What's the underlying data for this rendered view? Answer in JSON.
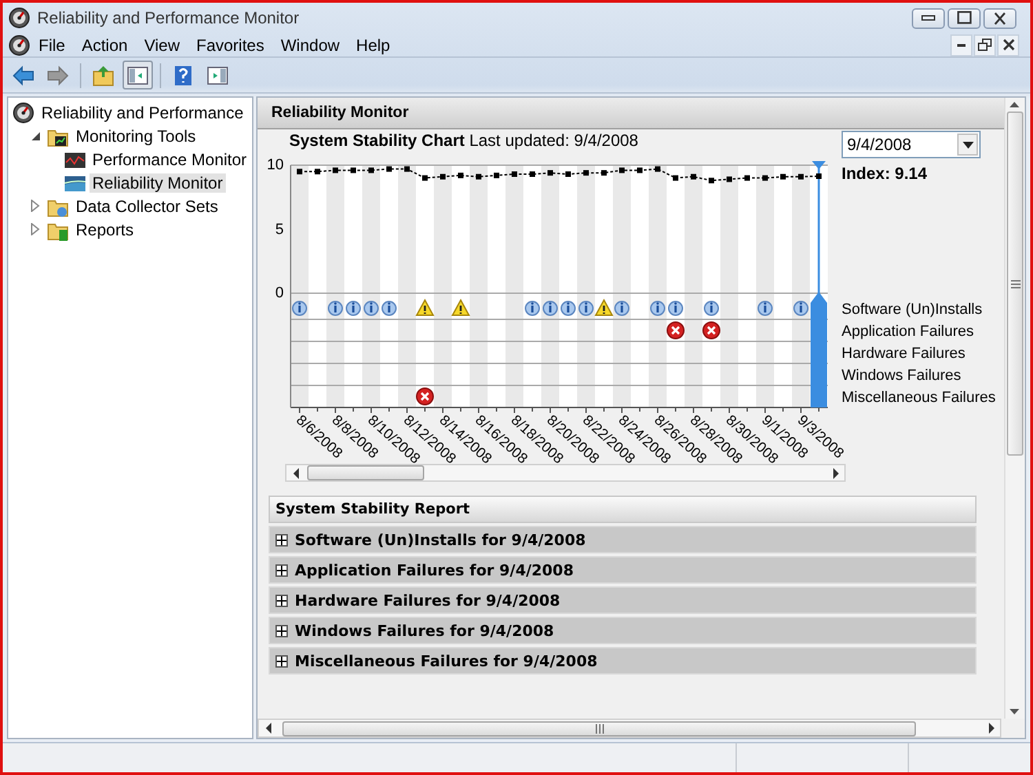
{
  "window": {
    "title": "Reliability and Performance Monitor"
  },
  "menu": [
    {
      "label": "File"
    },
    {
      "label": "Action"
    },
    {
      "label": "View"
    },
    {
      "label": "Favorites"
    },
    {
      "label": "Window"
    },
    {
      "label": "Help"
    }
  ],
  "toolbar": [
    {
      "kind": "back",
      "pressed": false
    },
    {
      "kind": "forward",
      "pressed": false
    },
    {
      "kind": "sep"
    },
    {
      "kind": "up",
      "pressed": false
    },
    {
      "kind": "tree",
      "pressed": true
    },
    {
      "kind": "sep"
    },
    {
      "kind": "help",
      "pressed": false
    },
    {
      "kind": "pane",
      "pressed": false
    }
  ],
  "tree": {
    "items": [
      {
        "label": "Reliability and Performance",
        "selected": false,
        "children": [
          {
            "label": "Monitoring Tools",
            "expanded": true,
            "selected": false,
            "children": [
              {
                "label": "Performance Monitor",
                "selected": false
              },
              {
                "label": "Reliability Monitor",
                "selected": true
              }
            ]
          },
          {
            "label": "Data Collector Sets",
            "expanded": false,
            "selected": false
          },
          {
            "label": "Reports",
            "expanded": false,
            "selected": false
          }
        ]
      }
    ]
  },
  "panel": {
    "title": "Reliability Monitor",
    "chart_title": "System Stability Chart",
    "last_updated": "Last updated: 9/4/2008",
    "date_field": {
      "value": "9/4/2008"
    },
    "index": "Index: 9.14",
    "lanes": [
      {
        "label": "Software (Un)Installs",
        "marks": [
          {
            "kind": "info"
          },
          {
            "kind": "none"
          },
          {
            "kind": "info"
          },
          {
            "kind": "info"
          },
          {
            "kind": "info"
          },
          {
            "kind": "info"
          },
          {
            "kind": "none"
          },
          {
            "kind": "warning"
          },
          {
            "kind": "none"
          },
          {
            "kind": "warning"
          },
          {
            "kind": "none"
          },
          {
            "kind": "none"
          },
          {
            "kind": "none"
          },
          {
            "kind": "info"
          },
          {
            "kind": "info"
          },
          {
            "kind": "info"
          },
          {
            "kind": "info"
          },
          {
            "kind": "warning"
          },
          {
            "kind": "info"
          },
          {
            "kind": "none"
          },
          {
            "kind": "info"
          },
          {
            "kind": "info"
          },
          {
            "kind": "none"
          },
          {
            "kind": "info"
          },
          {
            "kind": "none"
          },
          {
            "kind": "none"
          },
          {
            "kind": "info"
          },
          {
            "kind": "none"
          },
          {
            "kind": "info"
          },
          {
            "kind": "none"
          }
        ]
      },
      {
        "label": "Application Failures",
        "marks": [
          {
            "kind": "none"
          },
          {
            "kind": "none"
          },
          {
            "kind": "none"
          },
          {
            "kind": "none"
          },
          {
            "kind": "none"
          },
          {
            "kind": "none"
          },
          {
            "kind": "none"
          },
          {
            "kind": "none"
          },
          {
            "kind": "none"
          },
          {
            "kind": "none"
          },
          {
            "kind": "none"
          },
          {
            "kind": "none"
          },
          {
            "kind": "none"
          },
          {
            "kind": "none"
          },
          {
            "kind": "none"
          },
          {
            "kind": "none"
          },
          {
            "kind": "none"
          },
          {
            "kind": "none"
          },
          {
            "kind": "none"
          },
          {
            "kind": "none"
          },
          {
            "kind": "none"
          },
          {
            "kind": "error"
          },
          {
            "kind": "none"
          },
          {
            "kind": "error"
          },
          {
            "kind": "none"
          },
          {
            "kind": "none"
          },
          {
            "kind": "none"
          },
          {
            "kind": "none"
          },
          {
            "kind": "none"
          },
          {
            "kind": "none"
          }
        ]
      },
      {
        "label": "Hardware Failures"
      },
      {
        "label": "Windows Failures"
      },
      {
        "label": "Miscellaneous Failures",
        "marks": [
          {
            "kind": "none"
          },
          {
            "kind": "none"
          },
          {
            "kind": "none"
          },
          {
            "kind": "none"
          },
          {
            "kind": "none"
          },
          {
            "kind": "none"
          },
          {
            "kind": "none"
          },
          {
            "kind": "error"
          }
        ]
      }
    ],
    "scale_labels": [
      "10",
      "5",
      "0"
    ],
    "dates": [
      "8/6/2008",
      "8/8/2008",
      "8/10/2008",
      "8/12/2008",
      "8/14/2008",
      "8/16/2008",
      "8/18/2008",
      "8/20/2008",
      "8/22/2008",
      "8/24/2008",
      "8/26/2008",
      "8/28/2008",
      "8/30/2008",
      "9/1/2008",
      "9/3/2008"
    ],
    "report": {
      "title": "System Stability Report",
      "sections": [
        {
          "label": "Software (Un)Installs for 9/4/2008",
          "expanded": false
        },
        {
          "label": "Application Failures for 9/4/2008",
          "expanded": false
        },
        {
          "label": "Hardware Failures for 9/4/2008",
          "expanded": false
        },
        {
          "label": "Windows Failures for 9/4/2008",
          "expanded": false
        },
        {
          "label": "Miscellaneous Failures for 9/4/2008",
          "expanded": false
        }
      ]
    }
  }
}
